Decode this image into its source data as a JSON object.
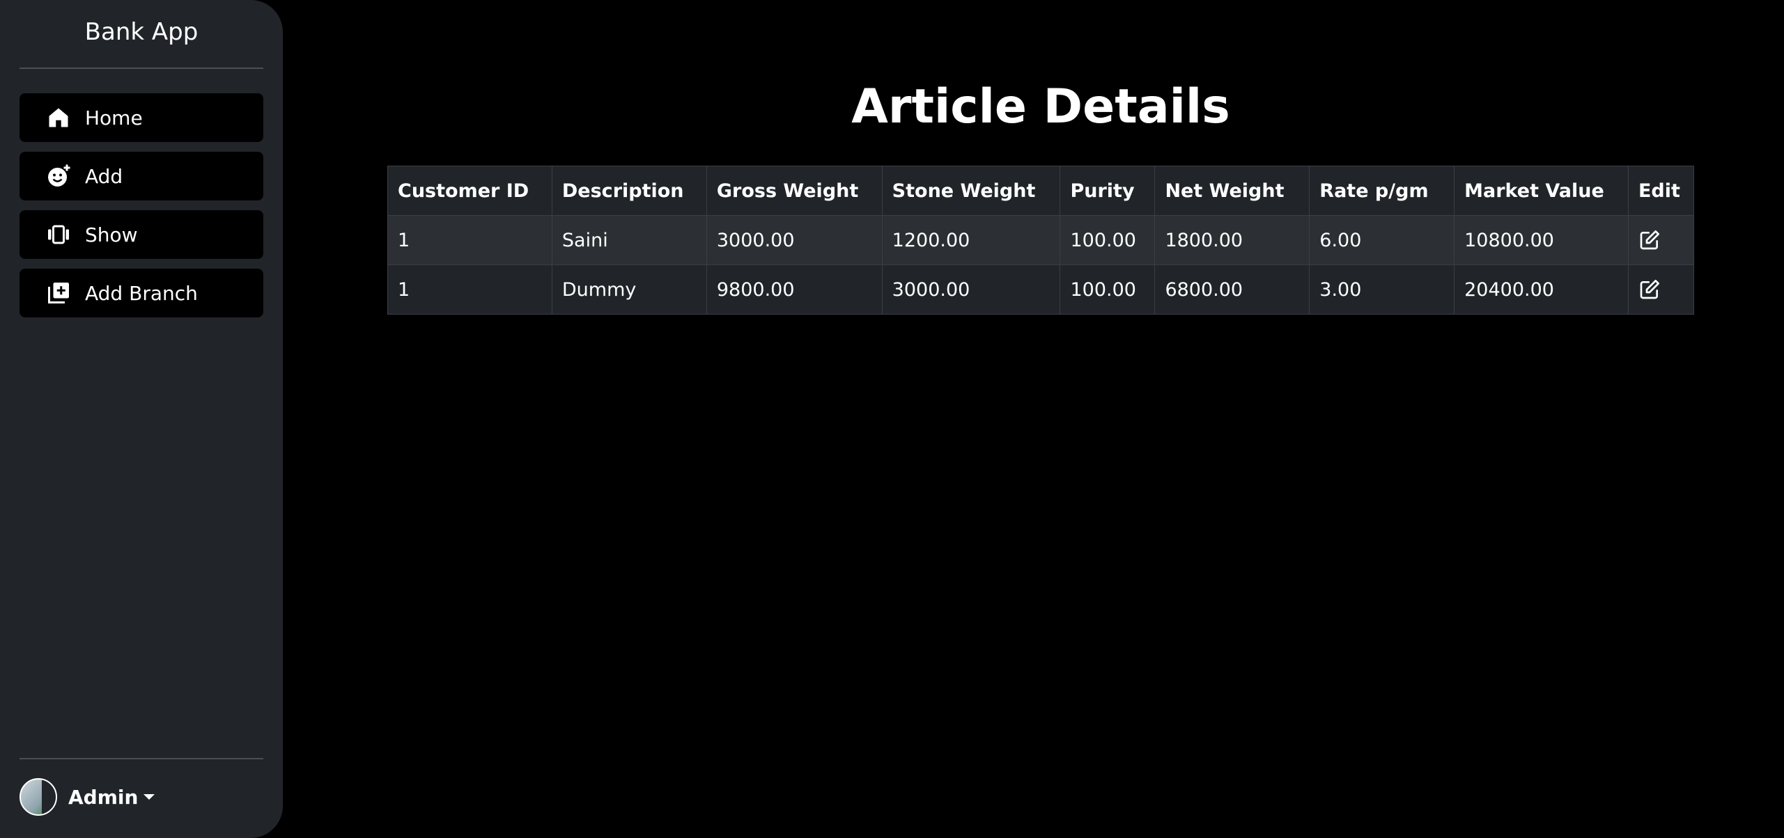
{
  "sidebar": {
    "brand": "Bank App",
    "items": [
      {
        "label": "Home",
        "icon": "home-icon"
      },
      {
        "label": "Add",
        "icon": "emoji-add-icon"
      },
      {
        "label": "Show",
        "icon": "carousel-icon"
      },
      {
        "label": "Add Branch",
        "icon": "add-library-icon"
      }
    ],
    "user": {
      "name": "Admin"
    }
  },
  "main": {
    "title": "Article Details",
    "table": {
      "columns": [
        "Customer ID",
        "Description",
        "Gross Weight",
        "Stone Weight",
        "Purity",
        "Net Weight",
        "Rate p/gm",
        "Market Value",
        "Edit"
      ],
      "rows": [
        {
          "customer_id": "1",
          "description": "Saini",
          "gross_weight": "3000.00",
          "stone_weight": "1200.00",
          "purity": "100.00",
          "net_weight": "1800.00",
          "rate": "6.00",
          "market_value": "10800.00"
        },
        {
          "customer_id": "1",
          "description": "Dummy",
          "gross_weight": "9800.00",
          "stone_weight": "3000.00",
          "purity": "100.00",
          "net_weight": "6800.00",
          "rate": "3.00",
          "market_value": "20400.00"
        }
      ]
    }
  },
  "colors": {
    "background": "#000000",
    "sidebar": "#212529",
    "table_header": "#212529",
    "table_row_odd": "#2c3034",
    "table_row_even": "#212529",
    "text": "#ffffff"
  }
}
